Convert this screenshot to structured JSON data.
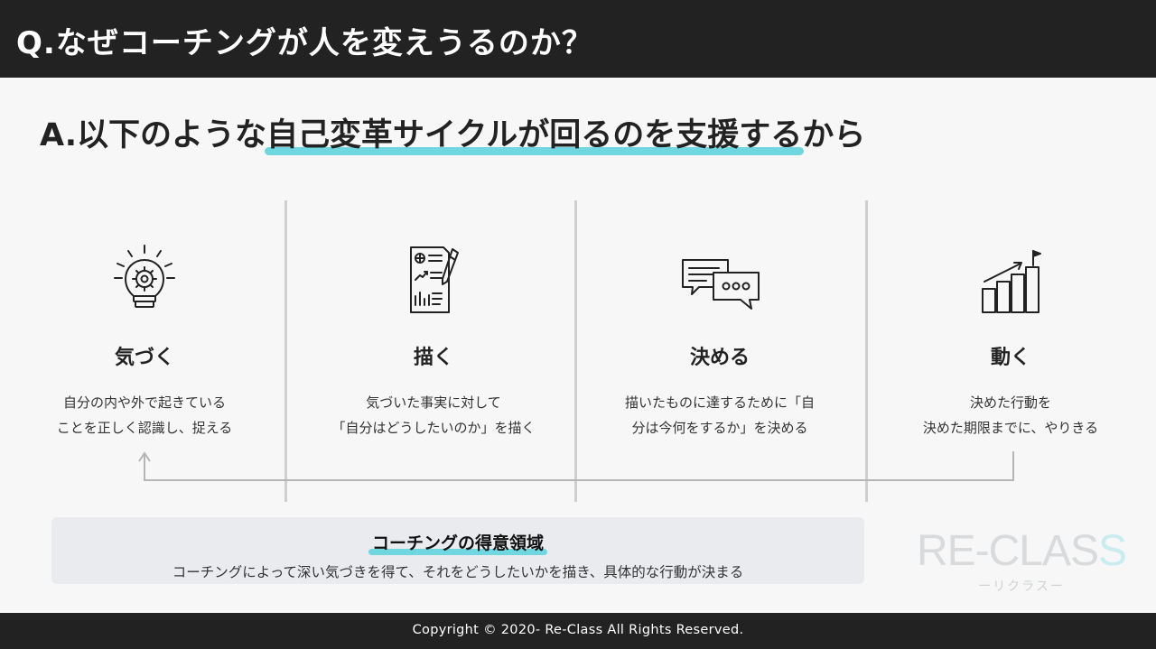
{
  "header": {
    "title": "Q.なぜコーチングが人を変えうるのか？"
  },
  "answer": {
    "prefix": "A.以下のような",
    "highlight": "自己変革サイクルが回るのを支援する",
    "suffix": "から"
  },
  "steps": [
    {
      "icon": "lightbulb-gear-icon",
      "title": "気づく",
      "desc_line1": "自分の内や外で起きている",
      "desc_line2": "ことを正しく認識し、捉える"
    },
    {
      "icon": "document-chart-pen-icon",
      "title": "描く",
      "desc_line1": "気づいた事実に対して",
      "desc_line2": "「自分はどうしたいのか」を描く"
    },
    {
      "icon": "speech-bubbles-icon",
      "title": "決める",
      "desc_line1": "描いたものに達するために「自",
      "desc_line2": "分は今何をするか」を決める"
    },
    {
      "icon": "growth-bar-chart-flag-icon",
      "title": "動く",
      "desc_line1": "決めた行動を",
      "desc_line2": "決めた期限までに、やりきる"
    }
  ],
  "summary": {
    "title": "コーチングの得意領域",
    "text": "コーチングによって深い気づきを得て、それをどうしたいかを描き、具体的な行動が決まる"
  },
  "logo": {
    "main_prefix": "RE-CLAS",
    "main_accent": "S",
    "sub": "ーリクラスー"
  },
  "footer": {
    "copyright": "Copyright © 2020- Re-Class All Rights Reserved."
  },
  "colors": {
    "dark_bar": "#222222",
    "accent_highlight": "#70d6e0",
    "background": "#f7f7f7",
    "summary_box": "#e9ebee"
  }
}
